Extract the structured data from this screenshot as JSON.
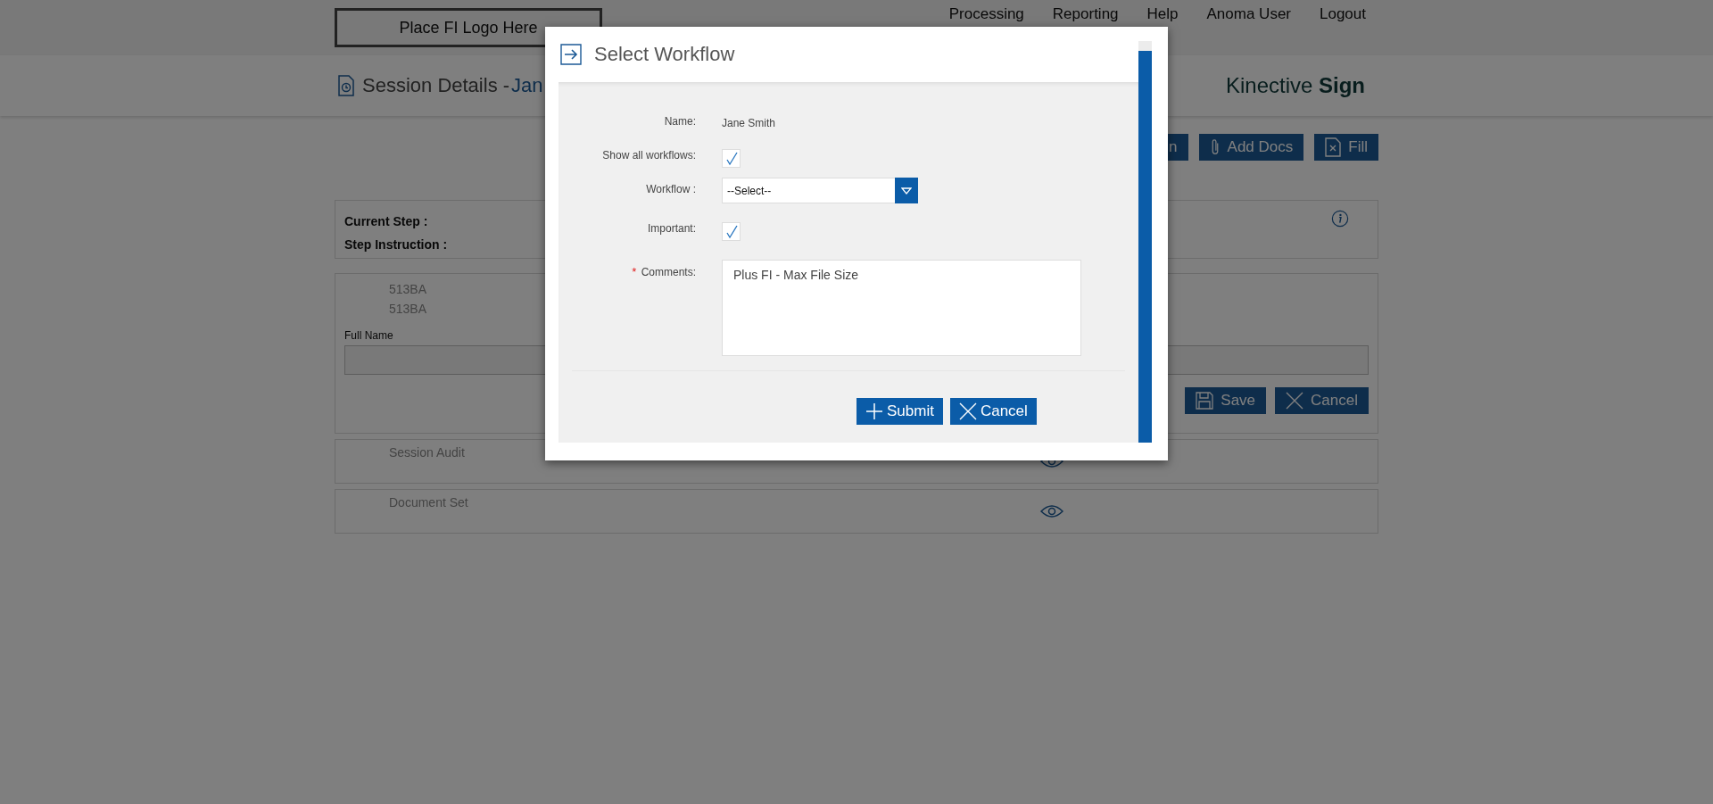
{
  "header": {
    "logo_text": "Place FI Logo Here",
    "nav": [
      {
        "label": "Processing"
      },
      {
        "label": "Reporting"
      },
      {
        "label": "Help"
      },
      {
        "label": "Anoma User"
      },
      {
        "label": "Logout"
      }
    ]
  },
  "subheader": {
    "title": "Session Details - ",
    "name": "Jan",
    "brand": "Kinective **Sign**"
  },
  "actions": [
    {
      "kind": "plain",
      "label": "n"
    },
    {
      "kind": "attach",
      "label": "Add Docs"
    },
    {
      "kind": "fill",
      "label": "Fill"
    }
  ],
  "step_panel": {
    "labels": [
      "Current Step :",
      "Step Instruction :"
    ]
  },
  "detail_panel": {
    "lines": [
      "513BA",
      "513BA"
    ],
    "field_label": "Full Name",
    "buttons": [
      {
        "kind": "save",
        "label": "Save"
      },
      {
        "kind": "cancel",
        "label": "Cancel"
      }
    ]
  },
  "sections": [
    {
      "title": "Session Audit"
    },
    {
      "title": "Document Set"
    }
  ],
  "modal": {
    "title": "Select Workflow",
    "required_mark": "*",
    "fields": [
      {
        "kind": "text",
        "label": "Name:",
        "required": false,
        "value": "Jane Smith"
      },
      {
        "kind": "checkbox",
        "label": "Show all workflows:",
        "required": false,
        "checked": true
      },
      {
        "kind": "select",
        "label": "Workflow :",
        "required": false,
        "value": "--Select--"
      },
      {
        "kind": "checkbox",
        "label": "Important:",
        "required": false,
        "checked": true
      },
      {
        "kind": "textarea",
        "label": "Comments:",
        "required": true,
        "value": "Plus FI - Max File Size"
      }
    ],
    "buttons": [
      {
        "kind": "submit",
        "label": "Submit"
      },
      {
        "kind": "cancel",
        "label": "Cancel"
      }
    ]
  }
}
